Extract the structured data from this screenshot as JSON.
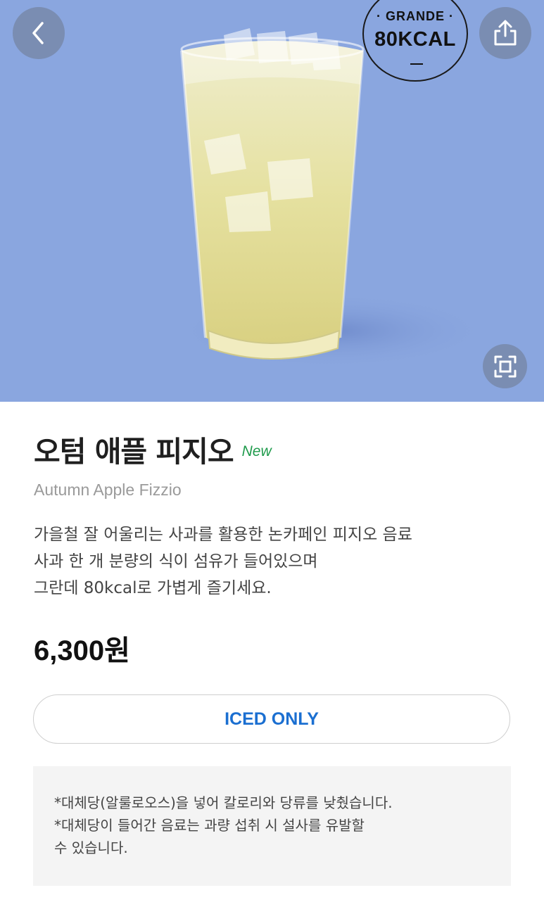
{
  "hero": {
    "background": "#8aa6df",
    "back_icon": "chevron-left-icon",
    "share_icon": "share-icon",
    "zoom_icon": "fullscreen-icon",
    "kcal_size": "· GRANDE ·",
    "kcal_value": "80KCAL"
  },
  "product": {
    "name": "오텀 애플 피지오",
    "new_label": "New",
    "english_name": "Autumn Apple Fizzio",
    "description": [
      "가을철 잘 어울리는 사과를 활용한 논카페인 피지오 음료",
      "사과 한 개 분량의 식이 섬유가 들어있으며",
      "그란데 80kcal로 가볍게 즐기세요."
    ],
    "price": "6,300원",
    "temperature_option": "ICED ONLY"
  },
  "notice": {
    "lines": [
      "*대체당(알룰로오스)을 넣어 칼로리와 당류를 낮췄습니다.",
      "*대체당이 들어간 음료는 과량 섭취 시 설사를 유발할",
      "수 있습니다."
    ]
  },
  "colors": {
    "accent_blue": "#1b6fd1",
    "new_green": "#1e9a4b"
  }
}
